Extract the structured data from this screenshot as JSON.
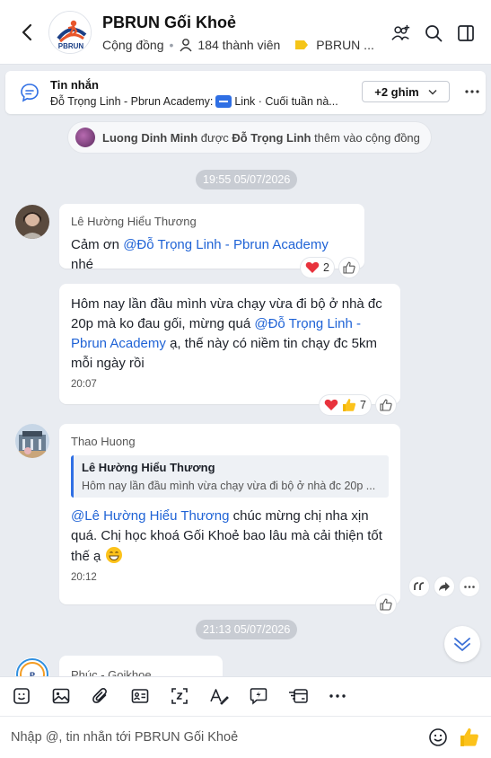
{
  "header": {
    "title": "PBRUN Gối Khoẻ",
    "type_label": "Cộng đồng",
    "member_count": "184 thành viên",
    "tag_label": "PBRUN ...",
    "logo_text": "PBRUN",
    "colors": {
      "tag": "#f5c518"
    }
  },
  "pinned": {
    "title": "Tin nhắn",
    "text_prefix": "Đỗ Trọng Linh - Pbrun Academy:",
    "text_suffix": "Link · Cuối tuần nà...",
    "more_label": "+2 ghim"
  },
  "system_notice": {
    "actor": "Luong Dinh Minh",
    "verb": "được",
    "target": "Đỗ Trọng Linh",
    "action": "thêm vào cộng đồng"
  },
  "timestamps": [
    "19:55 05/07/2026",
    "21:13 05/07/2026"
  ],
  "messages": [
    {
      "sender": "Lê Hường Hiểu Thương",
      "text_before": "Cảm ơn ",
      "mention": "@Đỗ Trọng Linh - Pbrun Academy",
      "text_after": " nhé",
      "reaction_count": "2"
    },
    {
      "text_before": "Hôm nay lần đầu mình vừa chạy vừa đi bộ ở nhà đc 20p mà ko đau gối, mừng quá ",
      "mention": "@Đỗ Trọng Linh - Pbrun Academy",
      "text_after": " ạ, thế này có niềm tin chạy đc 5km mỗi ngày rồi",
      "time": "20:07",
      "reaction_count": "7"
    },
    {
      "sender": "Thao Huong",
      "quote_name": "Lê Hường Hiểu Thương",
      "quote_text": "Hôm nay lần đầu mình vừa chạy vừa đi bộ ở nhà đc 20p ...",
      "mention": "@Lê Hường Hiểu Thương",
      "text_after": " chúc mừng chị nha xịn quá. Chị học khoá Gối Khoẻ bao lâu mà cải thiện tốt thế ạ ",
      "time": "20:12"
    },
    {
      "sender": "Phúc - Goikhoe"
    }
  ],
  "composer": {
    "placeholder": "Nhập @, tin nhắn tới PBRUN Gối Khoẻ"
  },
  "colors": {
    "accent": "#1f63d6",
    "background": "#e9ecf1",
    "timestamp_pill": "#c8ccd3"
  }
}
